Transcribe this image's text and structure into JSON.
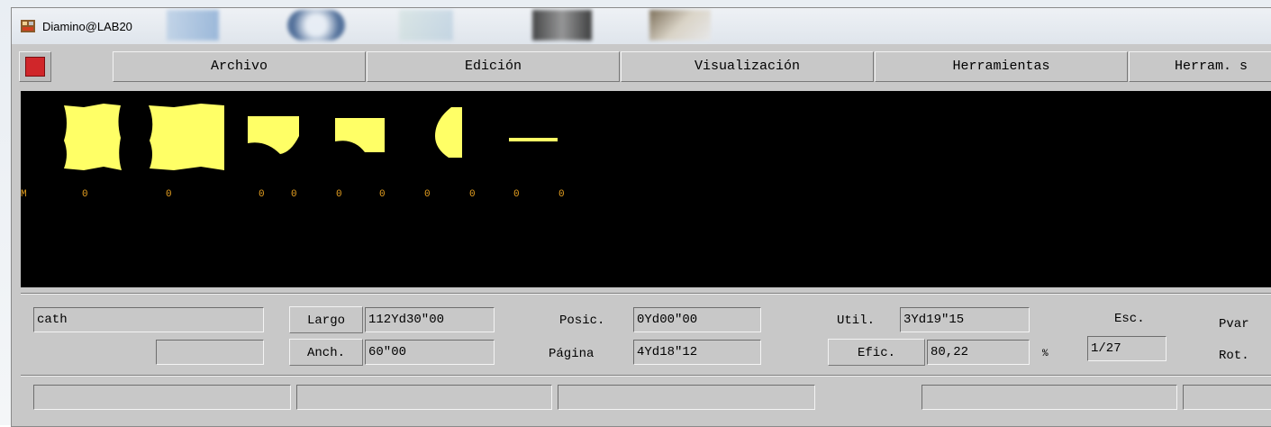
{
  "window": {
    "title": "Diamino@LAB20"
  },
  "menu": {
    "archivo": "Archivo",
    "edicion": "Edición",
    "visualizacion": "Visualización",
    "herramientas": "Herramientas",
    "herram2": "Herram. s"
  },
  "canvas": {
    "marker": "M",
    "counts": [
      "0",
      "0",
      "0",
      "0",
      "0",
      "0",
      "0",
      "0",
      "0",
      "0"
    ]
  },
  "status": {
    "name_field": "cath",
    "name_field_2": "",
    "largo_label": "Largo",
    "largo_value": "112Yd30\"00",
    "anch_label": "Anch.",
    "anch_value": "60\"00",
    "posic_label": "Posic.",
    "posic_value": "0Yd00\"00",
    "pagina_label": "Página",
    "pagina_value": "4Yd18\"12",
    "util_label": "Util.",
    "util_value": "3Yd19\"15",
    "efic_label": "Efic.",
    "efic_value": "80,22",
    "percent": "%",
    "esc_label": "Esc.",
    "esc_value": "1/27",
    "pvar_label": "Pvar",
    "rot_label": "Rot."
  },
  "bottom_fields": [
    "",
    "",
    "",
    "",
    ""
  ],
  "colors": {
    "piece": "#ffff66",
    "canvas": "#000000",
    "count_text": "#e6a020"
  }
}
